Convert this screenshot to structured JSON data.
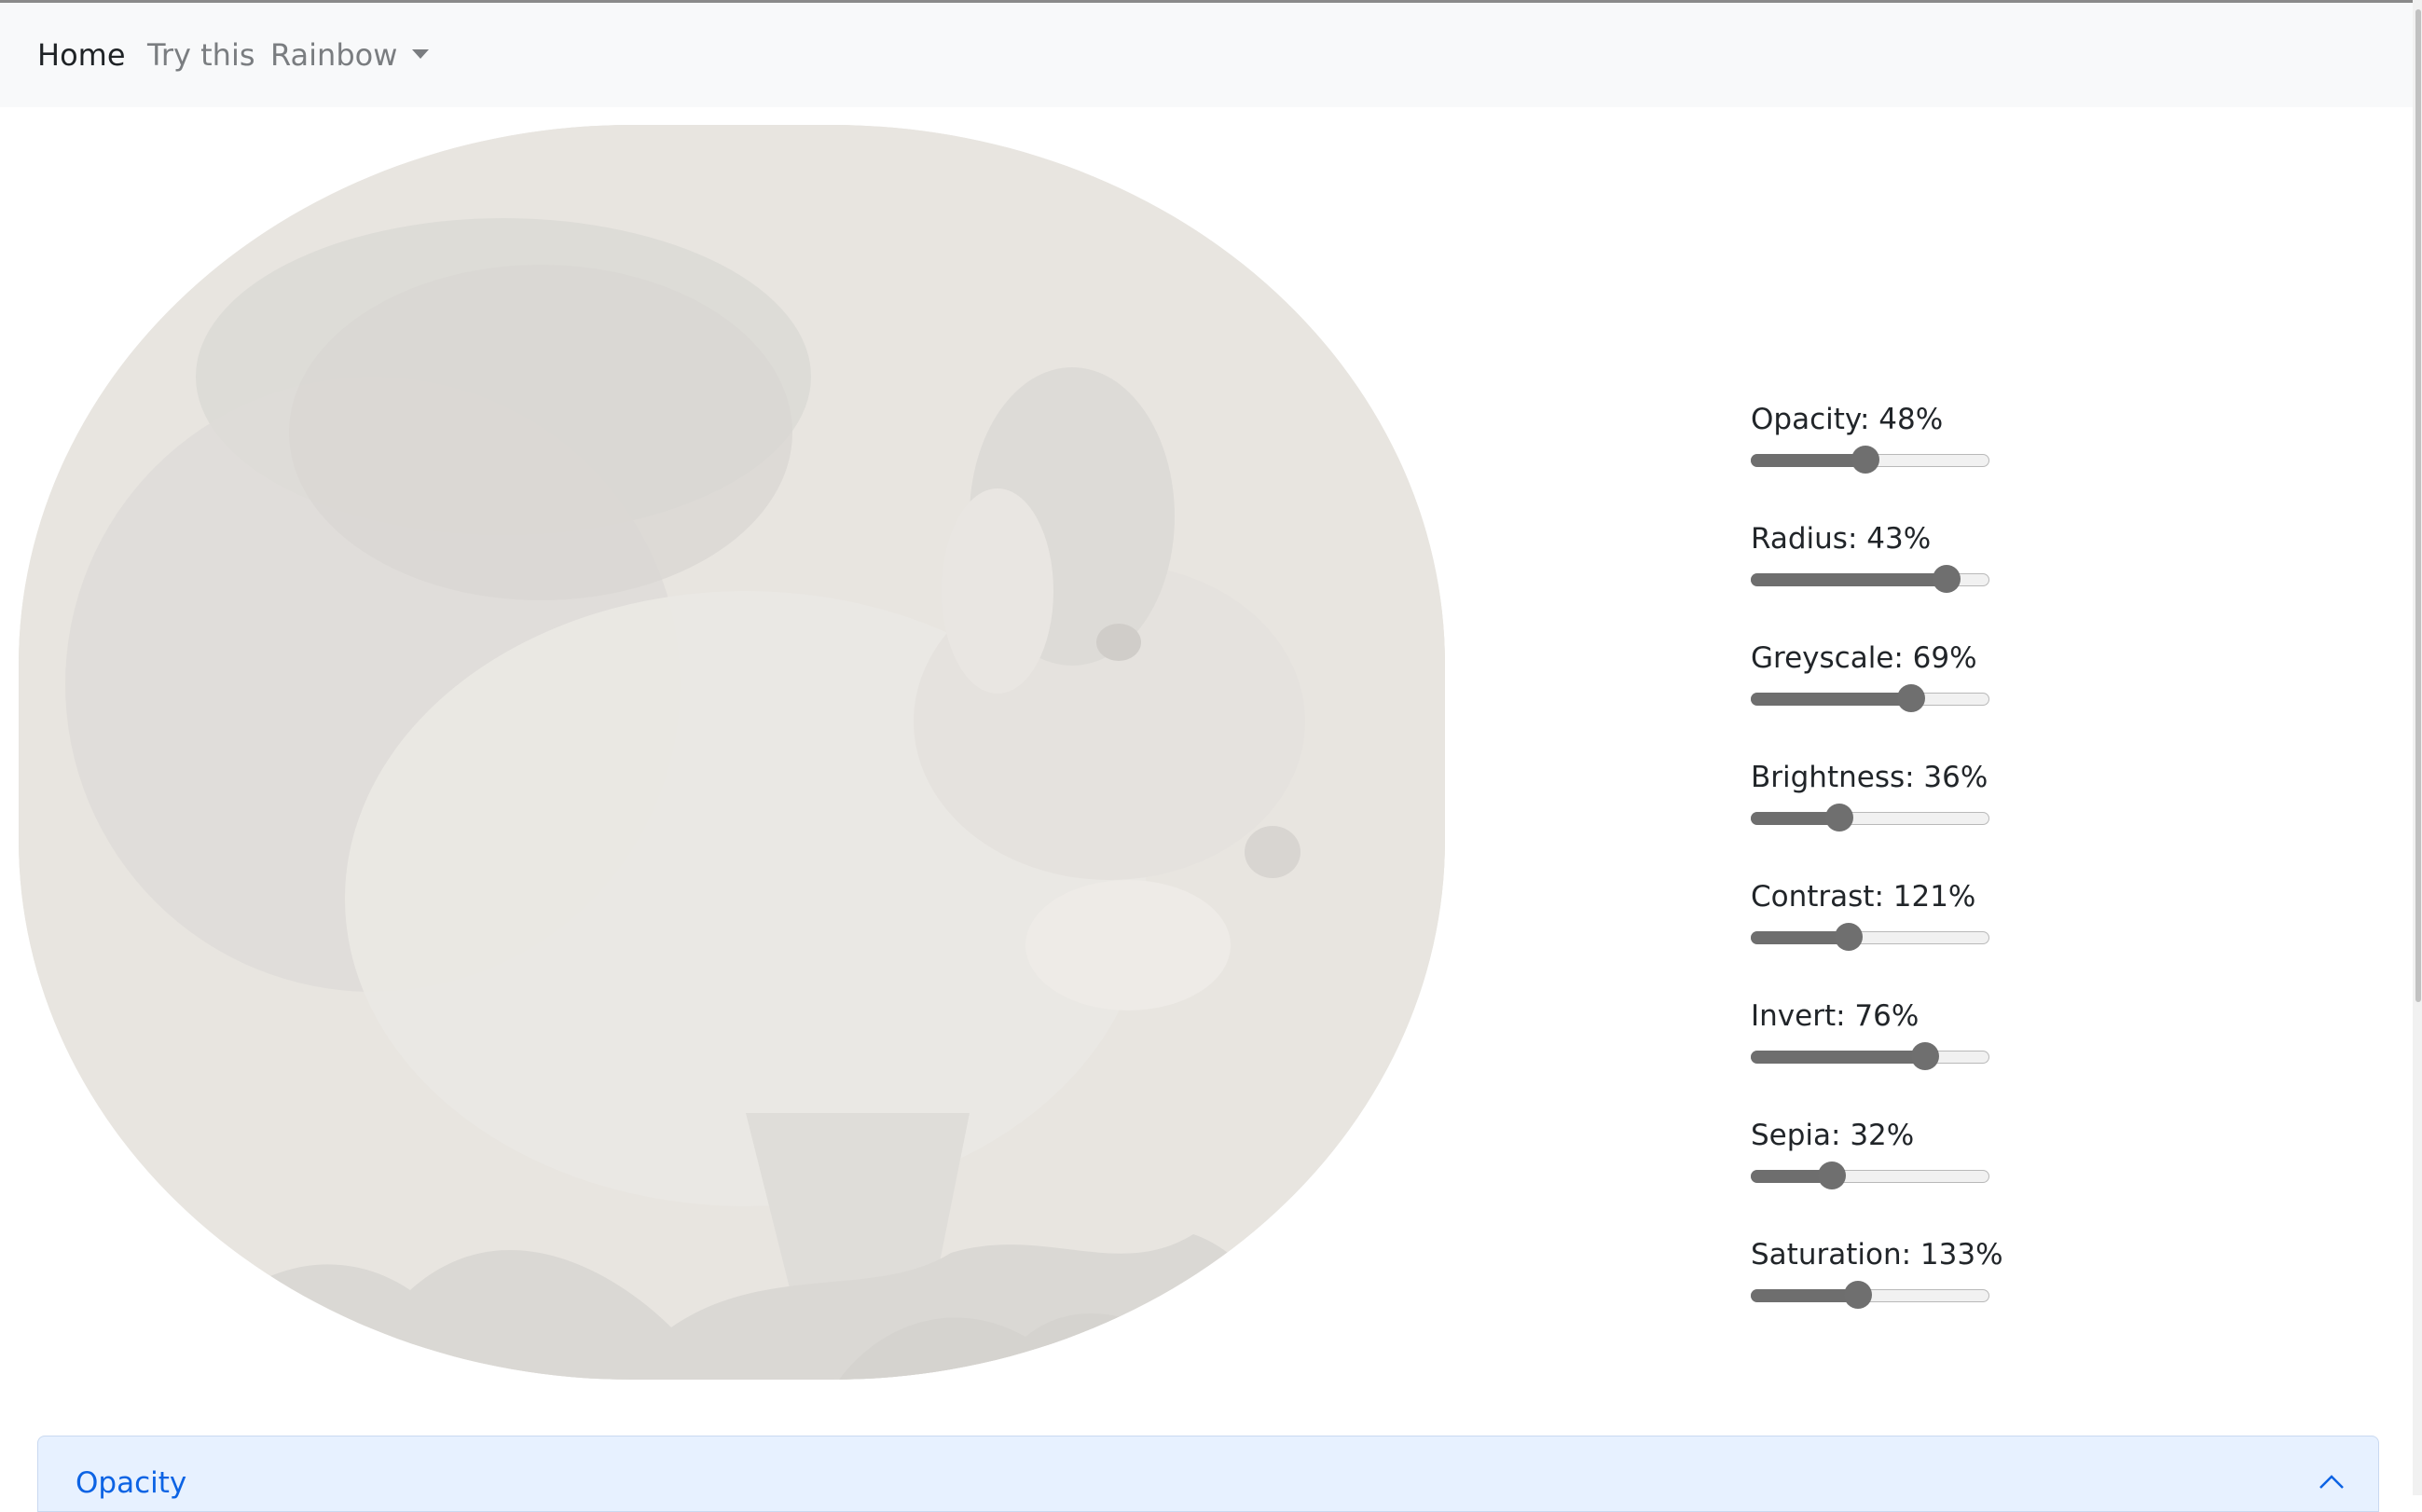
{
  "navbar": {
    "items": [
      {
        "label": "Home"
      },
      {
        "label": "Try this"
      },
      {
        "label": "Rainbow"
      }
    ]
  },
  "image": {
    "subject": "squirrel",
    "colors": {
      "background": "#e8e5e0",
      "fur": "#d9d7d4",
      "dark": "#cfcdca"
    }
  },
  "controls": [
    {
      "name": "Opacity",
      "label": "Opacity: 48%",
      "value": 48,
      "position": 0.48
    },
    {
      "name": "Radius",
      "label": "Radius: 43%",
      "value": 43,
      "position": 0.82
    },
    {
      "name": "Greyscale",
      "label": "Greyscale: 69%",
      "value": 69,
      "position": 0.67
    },
    {
      "name": "Brightness",
      "label": "Brightness: 36%",
      "value": 36,
      "position": 0.37
    },
    {
      "name": "Contrast",
      "label": "Contrast: 121%",
      "value": 121,
      "position": 0.41
    },
    {
      "name": "Invert",
      "label": "Invert: 76%",
      "value": 76,
      "position": 0.73
    },
    {
      "name": "Sepia",
      "label": "Sepia: 32%",
      "value": 32,
      "position": 0.34
    },
    {
      "name": "Saturation",
      "label": "Saturation: 133%",
      "value": 133,
      "position": 0.45
    }
  ],
  "accordion": {
    "title": "Opacity",
    "expanded": true
  },
  "colors": {
    "accent": "#0c63e4",
    "accordion_bg": "#e7f1ff",
    "slider": "#6f6f6f"
  }
}
